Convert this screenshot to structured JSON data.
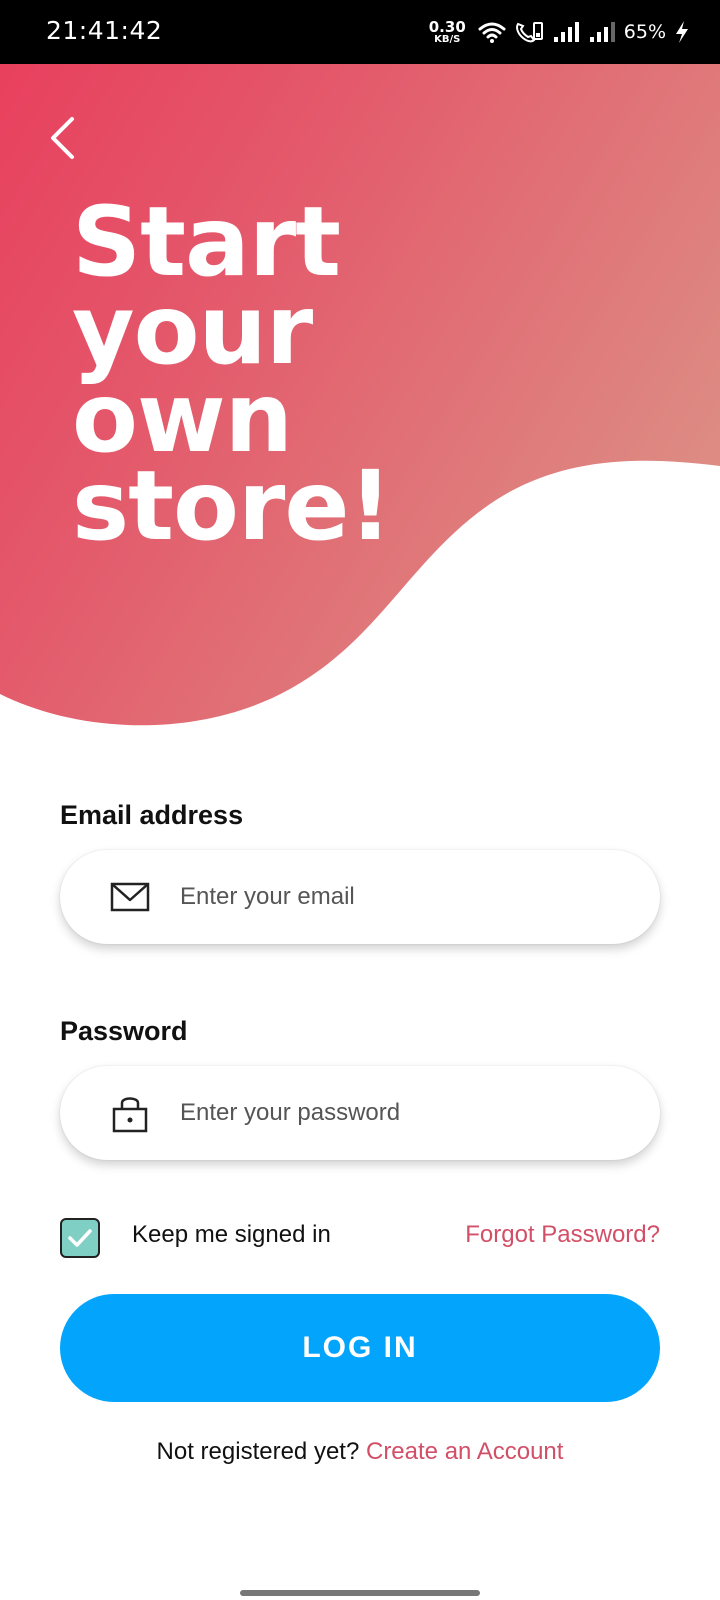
{
  "status_bar": {
    "time": "21:41:42",
    "net_speed_value": "0.30",
    "net_speed_unit": "KB/S",
    "battery": "65%",
    "icons": [
      "wifi-icon",
      "volte-icon",
      "signal-icon",
      "signal-icon",
      "charging-icon"
    ]
  },
  "hero": {
    "back_icon": "chevron-left-icon",
    "headline_lines": [
      "Start",
      "your",
      "own",
      "store!"
    ],
    "gradient_colors": [
      "#e8405e",
      "#de8a82"
    ]
  },
  "form": {
    "email_label": "Email address",
    "email_placeholder": "Enter your email",
    "email_value": "",
    "email_icon": "envelope-icon",
    "password_label": "Password",
    "password_placeholder": "Enter your password",
    "password_value": "",
    "password_icon": "lock-icon",
    "keep_signed_in_label": "Keep me signed in",
    "keep_signed_in_checked": true,
    "forgot_password": "Forgot Password?",
    "login_button": "LOG IN",
    "register_prompt": "Not registered yet?",
    "create_account": "Create an Account"
  },
  "colors": {
    "accent": "#03a4fc",
    "link": "#d24f68",
    "checkbox": "#7fcfc4"
  }
}
